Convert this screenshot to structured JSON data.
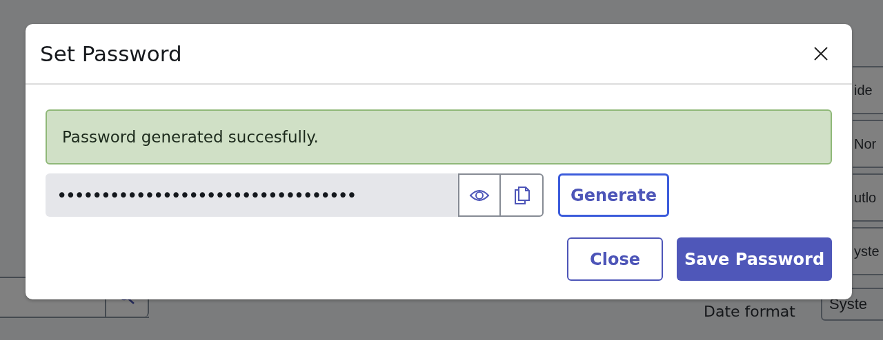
{
  "background": {
    "right_fields": [
      "ide",
      "Nor",
      "utlo",
      "yste",
      "Syste"
    ],
    "date_label": "Date format"
  },
  "dialog": {
    "title": "Set Password",
    "alert": {
      "kind": "success",
      "text": "Password generated succesfully."
    },
    "password": {
      "value": "••••••••••••••••••••••••••••••••••"
    },
    "generate_button": "Generate",
    "close_button": "Close",
    "save_button": "Save Password"
  }
}
